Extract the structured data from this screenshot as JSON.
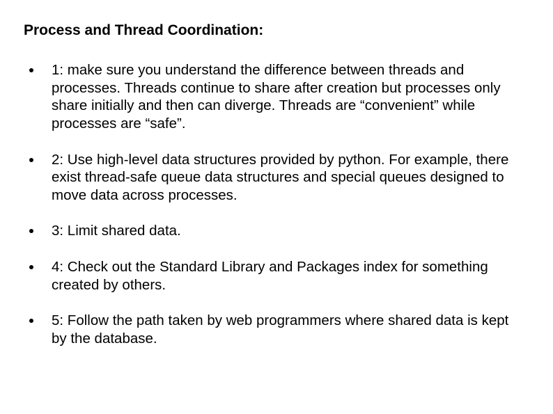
{
  "title": "Process and Thread Coordination:",
  "bullets": [
    {
      "text": "1: make sure you understand the difference between threads and processes. Threads continue to share after creation but processes only share initially and then can diverge. Threads are “convenient” while processes are “safe”."
    },
    {
      "text": "2: Use high-level data structures provided by python. For example, there exist thread-safe queue data structures and special queues designed to move data across processes."
    },
    {
      "text": "3: Limit shared data."
    },
    {
      "text": "4: Check out the Standard Library and Packages index for something created by others."
    },
    {
      "text": "5: Follow the path taken by web programmers where shared data is kept by the database."
    }
  ]
}
